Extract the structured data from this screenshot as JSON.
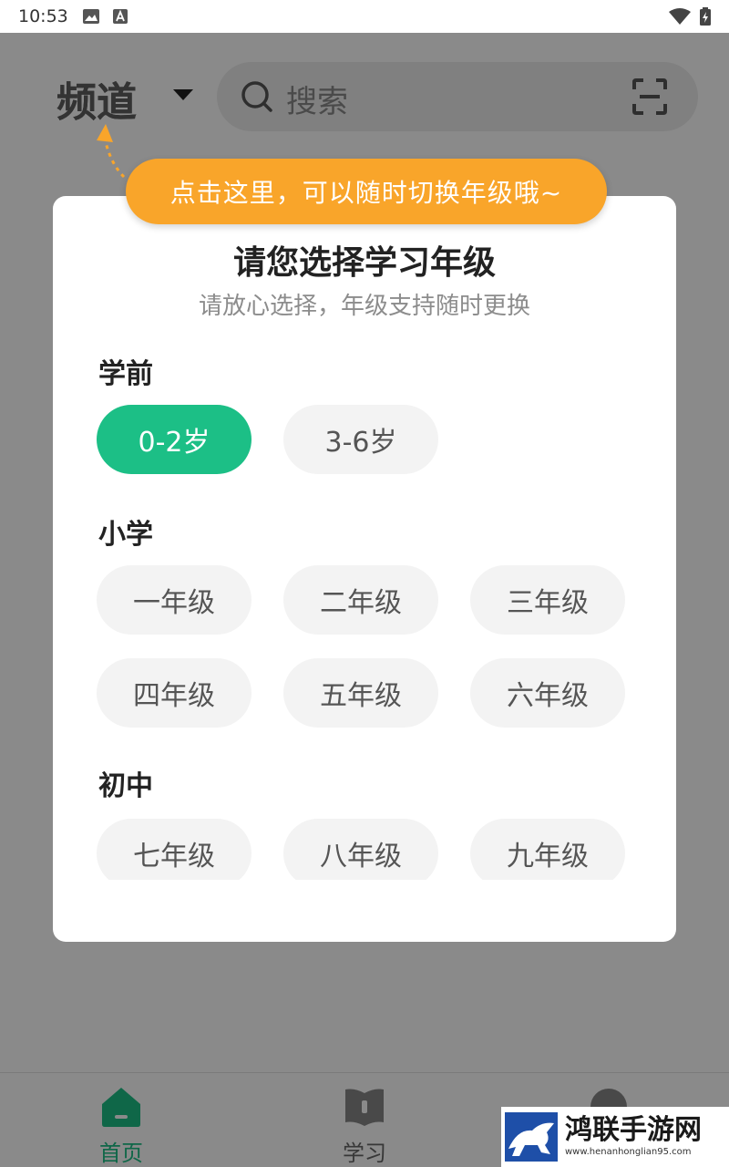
{
  "status_bar": {
    "time": "10:53"
  },
  "header": {
    "channel_label": "频道",
    "search_placeholder": "搜索"
  },
  "hint": {
    "text": "点击这里，可以随时切换年级哦~"
  },
  "dialog": {
    "title": "请您选择学习年级",
    "subtitle": "请放心选择，年级支持随时更换",
    "sections": [
      {
        "label": "学前",
        "grades": [
          "0-2岁",
          "3-6岁"
        ]
      },
      {
        "label": "小学",
        "grades": [
          "一年级",
          "二年级",
          "三年级",
          "四年级",
          "五年级",
          "六年级"
        ]
      },
      {
        "label": "初中",
        "grades": [
          "七年级",
          "八年级",
          "九年级"
        ]
      }
    ],
    "selected_grade": "0-2岁"
  },
  "tabbar": {
    "tabs": [
      {
        "label": "首页",
        "icon": "home-icon",
        "active": true
      },
      {
        "label": "学习",
        "icon": "book-icon",
        "active": false
      }
    ]
  },
  "watermark": {
    "title": "鸿联手游网",
    "url": "www.henanhonglian95.com"
  },
  "colors": {
    "accent_green": "#1cbf86",
    "hint_orange": "#f9a52a",
    "overlay": "rgba(0,0,0,0.46)"
  }
}
